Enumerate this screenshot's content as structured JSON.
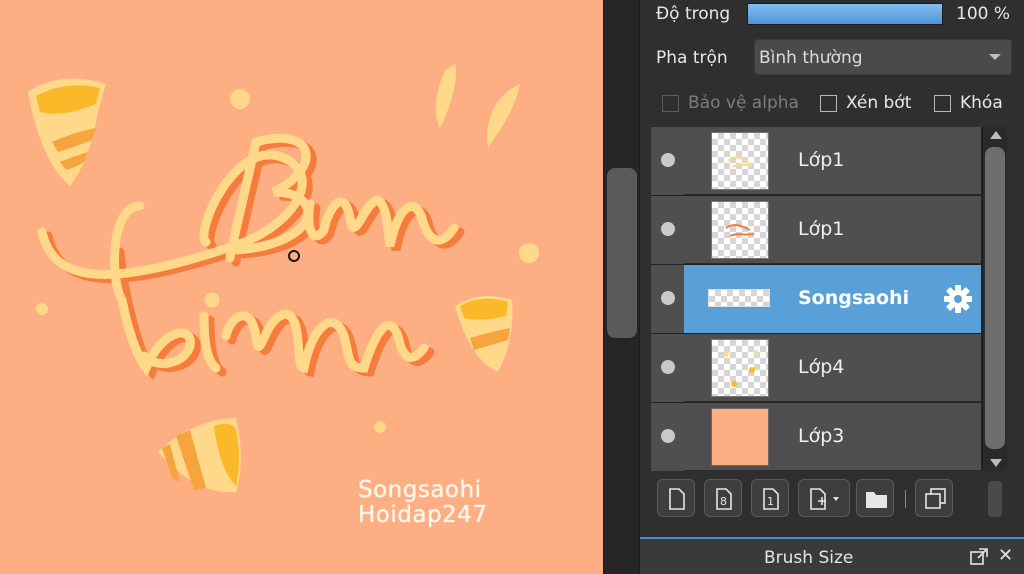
{
  "canvas": {
    "watermark_line1": "Songsaohi",
    "watermark_line2": "Hoidap247",
    "background": "#fdae83"
  },
  "layer_props": {
    "opacity_label": "Độ trong",
    "opacity_value": "100 %",
    "opacity_fraction": 1.0,
    "blend_label": "Pha trộn",
    "blend_value": "Bình thường",
    "protect_alpha_label": "Bảo vệ alpha",
    "clip_label": "Xén bớt",
    "lock_label": "Khóa"
  },
  "layers": [
    {
      "name": "Lớp1",
      "visible": true,
      "selected": false
    },
    {
      "name": "Lớp1",
      "visible": true,
      "selected": false
    },
    {
      "name": "Songsaohi",
      "visible": true,
      "selected": true
    },
    {
      "name": "Lớp4",
      "visible": true,
      "selected": false
    },
    {
      "name": "Lớp3",
      "visible": true,
      "selected": false
    }
  ],
  "toolbar": {
    "icons": [
      "new-layer-icon",
      "new-layer-8bit-icon",
      "new-layer-1bit-icon",
      "add-layer-dropdown-icon",
      "folder-icon",
      "duplicate-icon"
    ]
  },
  "bottom_panel": {
    "title": "Brush Size"
  },
  "colors": {
    "accent": "#5aa0d8",
    "panel_bg": "#2f2f2f",
    "layer_bg": "#4f4f4f",
    "lettering_light": "#ffd88a",
    "lettering_dark": "#f57c3c"
  }
}
